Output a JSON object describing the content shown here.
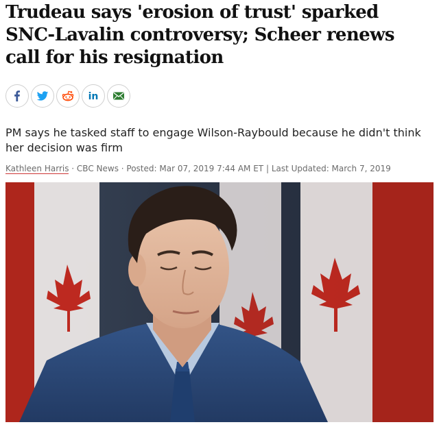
{
  "article": {
    "headline": "Trudeau says 'erosion of trust' sparked SNC-Lavalin controversy; Scheer renews call for his resignation",
    "subhead": "PM says he tasked staff to engage Wilson-Raybould because he didn't think her decision was firm",
    "byline": {
      "author": "Kathleen Harris",
      "sep1": " · ",
      "outlet": "CBC News",
      "sep2": " · ",
      "posted": "Posted: Mar 07, 2019 7:44 AM ET",
      "sep3": " | ",
      "updated": "Last Updated: March 7, 2019"
    }
  },
  "share": {
    "buttons": [
      {
        "icon": "facebook-icon",
        "color": "#3b5998"
      },
      {
        "icon": "twitter-icon",
        "color": "#1da1f2"
      },
      {
        "icon": "reddit-icon",
        "color": "#ff4500"
      },
      {
        "icon": "linkedin-icon",
        "color": "#0077b5"
      },
      {
        "icon": "email-icon",
        "color": "#2e7d32"
      }
    ]
  },
  "colors": {
    "author_underline": "#cc3333",
    "flag_red": "#d52b1e",
    "suit_blue": "#2c4a78"
  }
}
